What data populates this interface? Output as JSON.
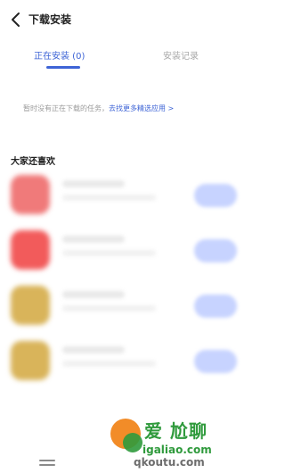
{
  "header": {
    "title": "下载安装",
    "back_icon": "chevron-left-icon"
  },
  "tabs": [
    {
      "label": "正在安装 (0)",
      "active": true
    },
    {
      "label": "安装记录",
      "active": false
    }
  ],
  "notice": {
    "text": "暂时没有正在下载的任务，",
    "link": "去找更多精选应用 >"
  },
  "recommend": {
    "title": "大家还喜欢"
  },
  "apps": [
    {
      "icon_color": "#f07a7a"
    },
    {
      "icon_color": "#f25b5b"
    },
    {
      "icon_color": "#d9b45a"
    },
    {
      "icon_color": "#d9b45a"
    }
  ],
  "colors": {
    "accent": "#3e64d6",
    "watermark": "#2f9a3c"
  },
  "watermark": {
    "text": "爱 尬聊",
    "url": "igaliao.com",
    "url2": "qkoutu.com"
  }
}
